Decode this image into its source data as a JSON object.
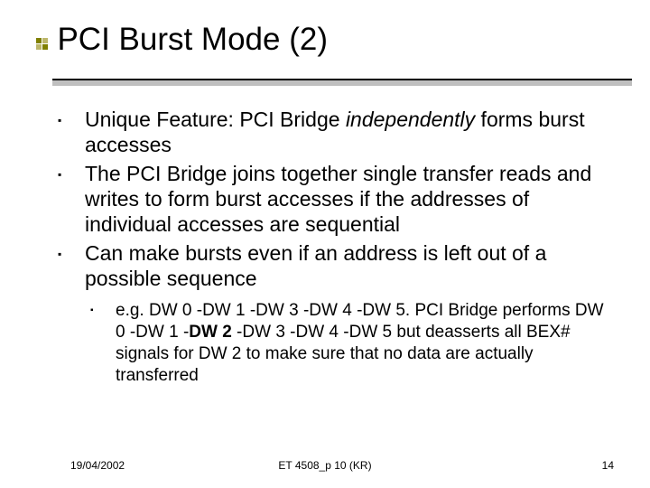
{
  "title": "PCI Burst Mode (2)",
  "bullets": {
    "b1_a": "Unique Feature: PCI Bridge ",
    "b1_em": "independently",
    "b1_b": " forms burst accesses",
    "b2": "The PCI Bridge joins together single transfer reads and writes to form burst accesses if the addresses of individual accesses are sequential",
    "b3": "Can make bursts even if an address is left out of a possible sequence",
    "sub_a": "e.g. DW 0 -DW 1 -DW 3 -DW 4 -DW 5.  PCI Bridge performs DW 0 -DW 1 -",
    "sub_bold": "DW 2",
    "sub_b": " -DW 3 -DW 4 -DW 5 but deasserts all BEX# signals for DW 2 to make sure that no data are actually transferred"
  },
  "footer": {
    "date": "19/04/2002",
    "mid": "ET 4508_p 10 (KR)",
    "page": "14"
  }
}
